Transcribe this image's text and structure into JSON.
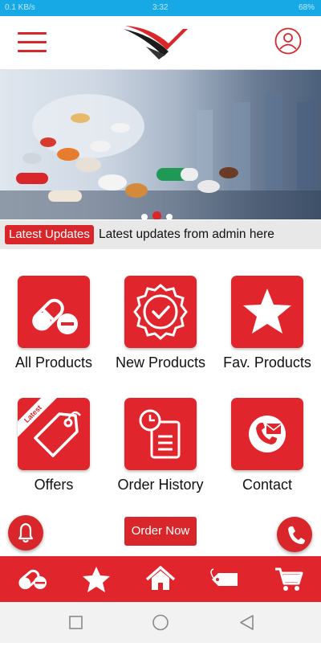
{
  "status_bar": {
    "left": "0.1 KB/s",
    "center": "3:32",
    "right": "68%"
  },
  "ticker": {
    "tag": "Latest Updates",
    "message": "Latest updates from admin here"
  },
  "tiles": [
    {
      "label": "All Products",
      "icon": "pills-icon"
    },
    {
      "label": "New Products",
      "icon": "badge-check-icon"
    },
    {
      "label": "Fav. Products",
      "icon": "star-icon"
    },
    {
      "label": "Offers",
      "icon": "price-tag-icon",
      "ribbon": "Latest"
    },
    {
      "label": "Order History",
      "icon": "clipboard-clock-icon"
    },
    {
      "label": "Contact",
      "icon": "contact-phone-icon"
    }
  ],
  "order_button": {
    "label": "Order Now"
  },
  "bottom_nav": [
    "pills-icon",
    "star-icon",
    "home-icon",
    "tag-icon",
    "cart-icon"
  ],
  "carousel": {
    "slides": 3,
    "active": 2
  },
  "colors": {
    "brand": "#e0262c",
    "status": "#17a9e6"
  }
}
